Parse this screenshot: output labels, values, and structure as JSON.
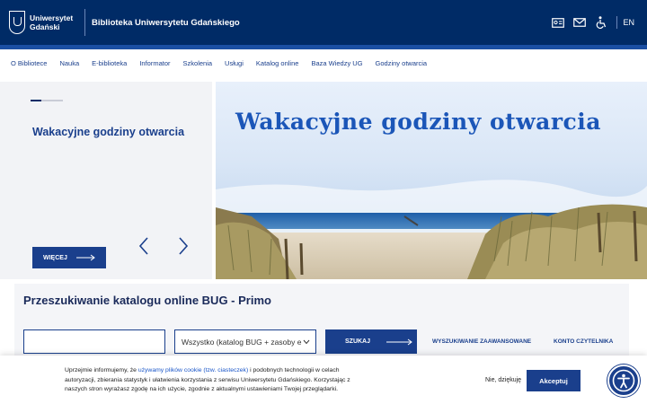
{
  "header": {
    "logo_line1": "Uniwersytet",
    "logo_line2": "Gdański",
    "site_title": "Biblioteka Uniwersytetu Gdańskiego",
    "lang": "EN",
    "icons": [
      "card-icon",
      "mail-icon",
      "wheelchair-icon"
    ]
  },
  "nav": {
    "items": [
      "O Bibliotece",
      "Nauka",
      "E-biblioteka",
      "Informator",
      "Szkolenia",
      "Usługi",
      "Katalog online",
      "Baza Wiedzy UG",
      "Godziny otwarcia"
    ]
  },
  "hero": {
    "title": "Wakacyjne godziny otwarcia",
    "more_label": "WIĘCEJ",
    "image_title": "Wakacyjne godziny otwarcia"
  },
  "search": {
    "title": "Przeszukiwanie katalogu online BUG - Primo",
    "input_value": "",
    "select_value": "Wszystko (katalog BUG + zasoby e",
    "button_label": "SZUKAJ",
    "advanced_link": "WYSZUKIWANIE ZAAWANSOWANE",
    "account_link": "KONTO CZYTELNIKA"
  },
  "cookie": {
    "text_before": "Uprzejmie informujemy, że ",
    "link_text": "używamy plików cookie (tzw. ciasteczek)",
    "text_after": " i podobnych technologii w celach autoryzacji, zbierania statystyk i ułatwienia korzystania z serwisu Uniwersytetu Gdańskiego. Korzystając z naszych stron wyrażasz zgodę na ich użycie, zgodnie z aktualnymi ustawieniami Twojej przeglądarki.",
    "decline_label": "Nie, dziękuję",
    "accept_label": "Akceptuj"
  },
  "colors": {
    "primary": "#002b66",
    "accent": "#1a3f8c",
    "link": "#1a56c8"
  }
}
